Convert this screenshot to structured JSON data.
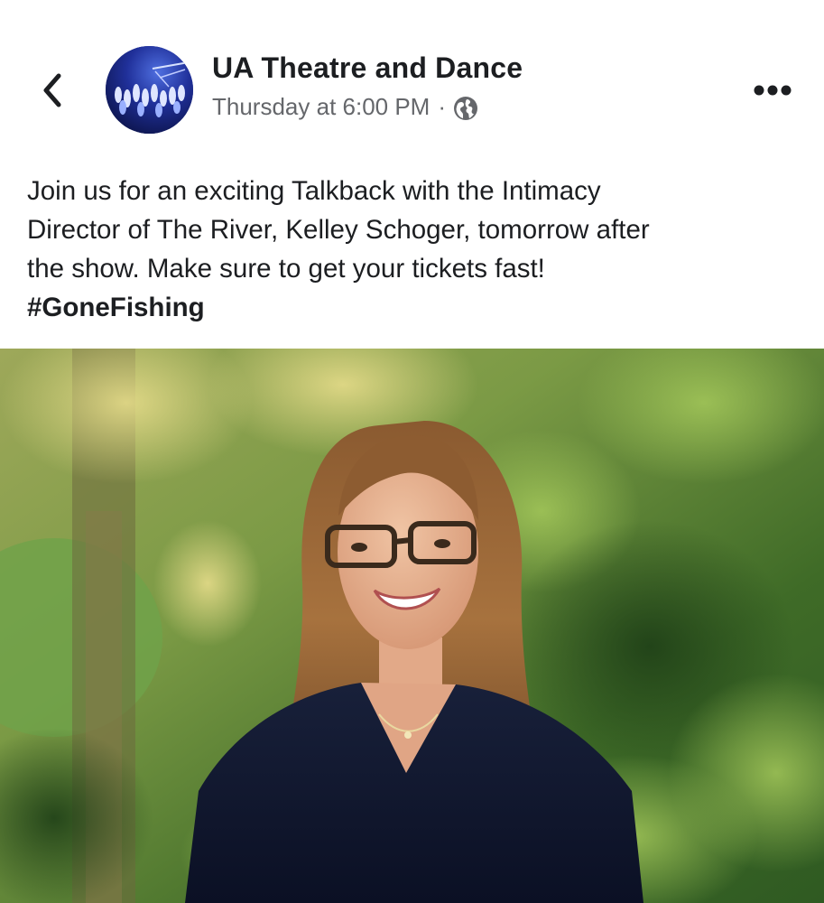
{
  "post": {
    "page_name": "UA Theatre and Dance",
    "timestamp": "Thursday at 6:00 PM",
    "separator": "·",
    "audience_icon": "globe-icon",
    "text_lines": [
      "Join us for an exciting Talkback with the Intimacy",
      "Director of The River, Kelley Schoger, tomorrow after",
      "the show. Make sure to get your tickets fast!"
    ],
    "hashtag": "#GoneFishing"
  },
  "icons": {
    "back": "chevron-left-icon",
    "more": "more-horizontal-icon",
    "avatar": "theatre-stage-avatar"
  },
  "colors": {
    "text_primary": "#1c1e21",
    "text_secondary": "#65676b",
    "background": "#ffffff"
  }
}
